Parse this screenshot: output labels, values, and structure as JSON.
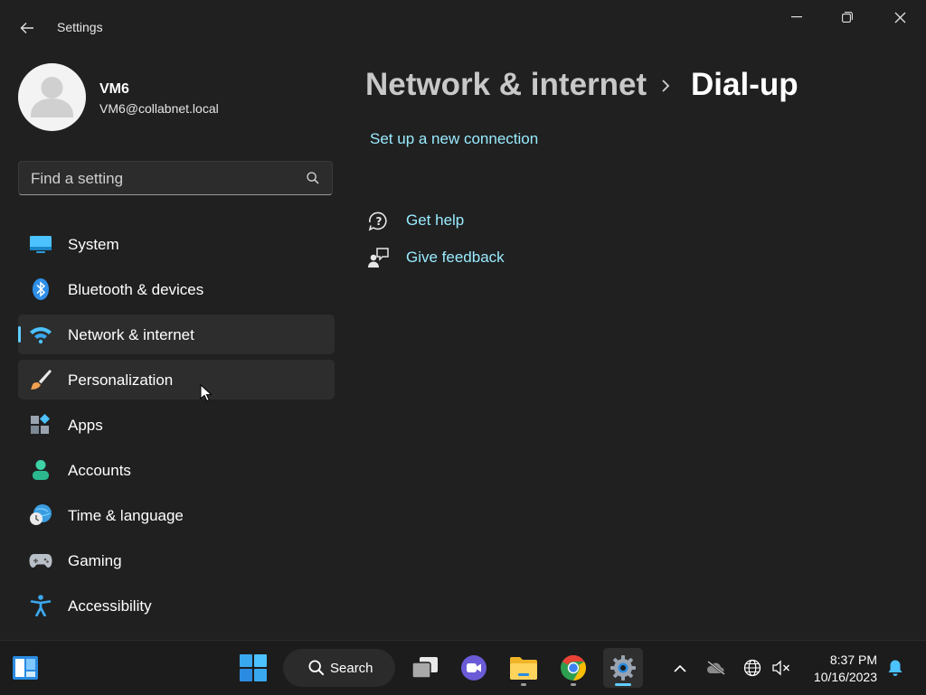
{
  "window": {
    "title": "Settings",
    "back_icon": "back-arrow-icon",
    "minimize_icon": "minimize-icon",
    "maximize_icon": "restore-icon",
    "close_icon": "close-icon"
  },
  "profile": {
    "name": "VM6",
    "email": "VM6@collabnet.local"
  },
  "search": {
    "placeholder": "Find a setting",
    "icon": "search-icon"
  },
  "nav": {
    "items": [
      {
        "label": "System",
        "icon": "system-icon"
      },
      {
        "label": "Bluetooth & devices",
        "icon": "bluetooth-icon"
      },
      {
        "label": "Network & internet",
        "icon": "wifi-icon",
        "selected": true
      },
      {
        "label": "Personalization",
        "icon": "paintbrush-icon"
      },
      {
        "label": "Apps",
        "icon": "apps-icon"
      },
      {
        "label": "Accounts",
        "icon": "accounts-icon"
      },
      {
        "label": "Time & language",
        "icon": "time-language-icon"
      },
      {
        "label": "Gaming",
        "icon": "gaming-icon"
      },
      {
        "label": "Accessibility",
        "icon": "accessibility-icon"
      }
    ]
  },
  "main": {
    "breadcrumb_parent": "Network & internet",
    "breadcrumb_separator": ">",
    "breadcrumb_current": "Dial-up",
    "setup_link": "Set up a new connection",
    "get_help": "Get help",
    "give_feedback": "Give feedback"
  },
  "taskbar": {
    "search_label": "Search",
    "apps": [
      "start-icon",
      "task-view-icon",
      "teams-chat-icon",
      "file-explorer-icon",
      "chrome-icon",
      "settings-icon"
    ],
    "tray_icons": [
      "chevron-up-icon",
      "onedrive-offline-icon",
      "network-globe-icon",
      "volume-muted-icon",
      "notification-bell-icon"
    ],
    "time": "8:37 PM",
    "date": "10/16/2023"
  },
  "colors": {
    "background": "#202020",
    "accent": "#60cdff",
    "link": "#99ebff",
    "taskbar": "#1c1c1c"
  }
}
